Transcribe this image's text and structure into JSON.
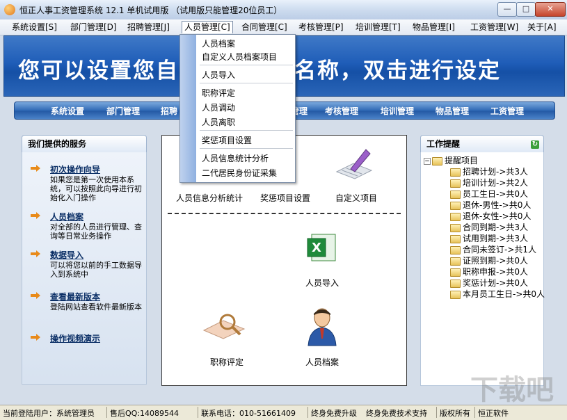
{
  "window": {
    "title": "恒正人事工资管理系统 12.1 单机试用版 （试用版只能管理20位员工）",
    "min_label": "—",
    "max_label": "□",
    "close_label": "✕"
  },
  "menubar": [
    {
      "label": "系统设置[S]"
    },
    {
      "label": "部门管理[D]"
    },
    {
      "label": "招聘管理[J]"
    },
    {
      "label": "人员管理[C]"
    },
    {
      "label": "合同管理[C]"
    },
    {
      "label": "考核管理[P]"
    },
    {
      "label": "培训管理[T]"
    },
    {
      "label": "物品管理[I]"
    },
    {
      "label": "工资管理[W]"
    },
    {
      "label": "关于[A]"
    }
  ],
  "dropdown": [
    {
      "label": "人员档案"
    },
    {
      "label": "自定义人员档案项目"
    },
    {
      "label": "人员导入"
    },
    {
      "label": "职称评定"
    },
    {
      "label": "人员调动"
    },
    {
      "label": "人员离职"
    },
    {
      "label": "奖惩项目设置"
    },
    {
      "label": "人员信息统计分析"
    },
    {
      "label": "二代居民身份证采集"
    }
  ],
  "banner": {
    "text": "您可以设置您自己的公司名称，双击进行设定",
    "visible_left": "您可以设置您自",
    "visible_right": "名称，双击进行设定"
  },
  "navbar": [
    {
      "label": "系统设置"
    },
    {
      "label": "部门管理"
    },
    {
      "label": "招聘"
    },
    {
      "label": "管理"
    },
    {
      "label": "考核管理"
    },
    {
      "label": "培训管理"
    },
    {
      "label": "物品管理"
    },
    {
      "label": "工资管理"
    }
  ],
  "services": {
    "title": "我们提供的服务",
    "items": [
      {
        "title": "初次操作向导",
        "desc": "如果您是第一次使用本系统，可以按照此向导进行初始化入门操作"
      },
      {
        "title": "人员档案",
        "desc": "对全部的人员进行管理、查询等日常业务操作"
      },
      {
        "title": "数据导入",
        "desc": "可以将您以前的手工数据导入到系统中"
      },
      {
        "title": "查看最新版本",
        "desc": "登陆网站查看软件最新版本"
      },
      {
        "title": "操作视频演示",
        "desc": ""
      }
    ]
  },
  "center": {
    "icons": [
      {
        "label": "人员信息分析统计"
      },
      {
        "label": "奖惩项目设置"
      },
      {
        "label": "自定义项目"
      },
      {
        "label": "人员导入"
      },
      {
        "label": "职称评定"
      },
      {
        "label": "人员档案"
      }
    ]
  },
  "reminders": {
    "title": "工作提醒",
    "root": "提醒项目",
    "items": [
      {
        "label": "招聘计划->共3人"
      },
      {
        "label": "培训计划->共2人"
      },
      {
        "label": "员工生日->共0人"
      },
      {
        "label": "退休-男性->共0人"
      },
      {
        "label": "退休-女性->共0人"
      },
      {
        "label": "合同到期->共3人"
      },
      {
        "label": "试用到期->共3人"
      },
      {
        "label": "合同未签订->共1人"
      },
      {
        "label": "证照到期->共0人"
      },
      {
        "label": "职称申报->共0人"
      },
      {
        "label": "奖惩计划->共0人"
      },
      {
        "label": "本月员工生日->共0人"
      }
    ]
  },
  "statusbar": {
    "user": "当前登陆用户：系统管理员",
    "qq": "售后QQ:14089544",
    "phone": "联系电话：010-51661409",
    "upgrade": "终身免费升级",
    "support": "终身免费技术支持",
    "copyright": "版权所有",
    "company": "恒正软件"
  },
  "watermark": "下载吧"
}
